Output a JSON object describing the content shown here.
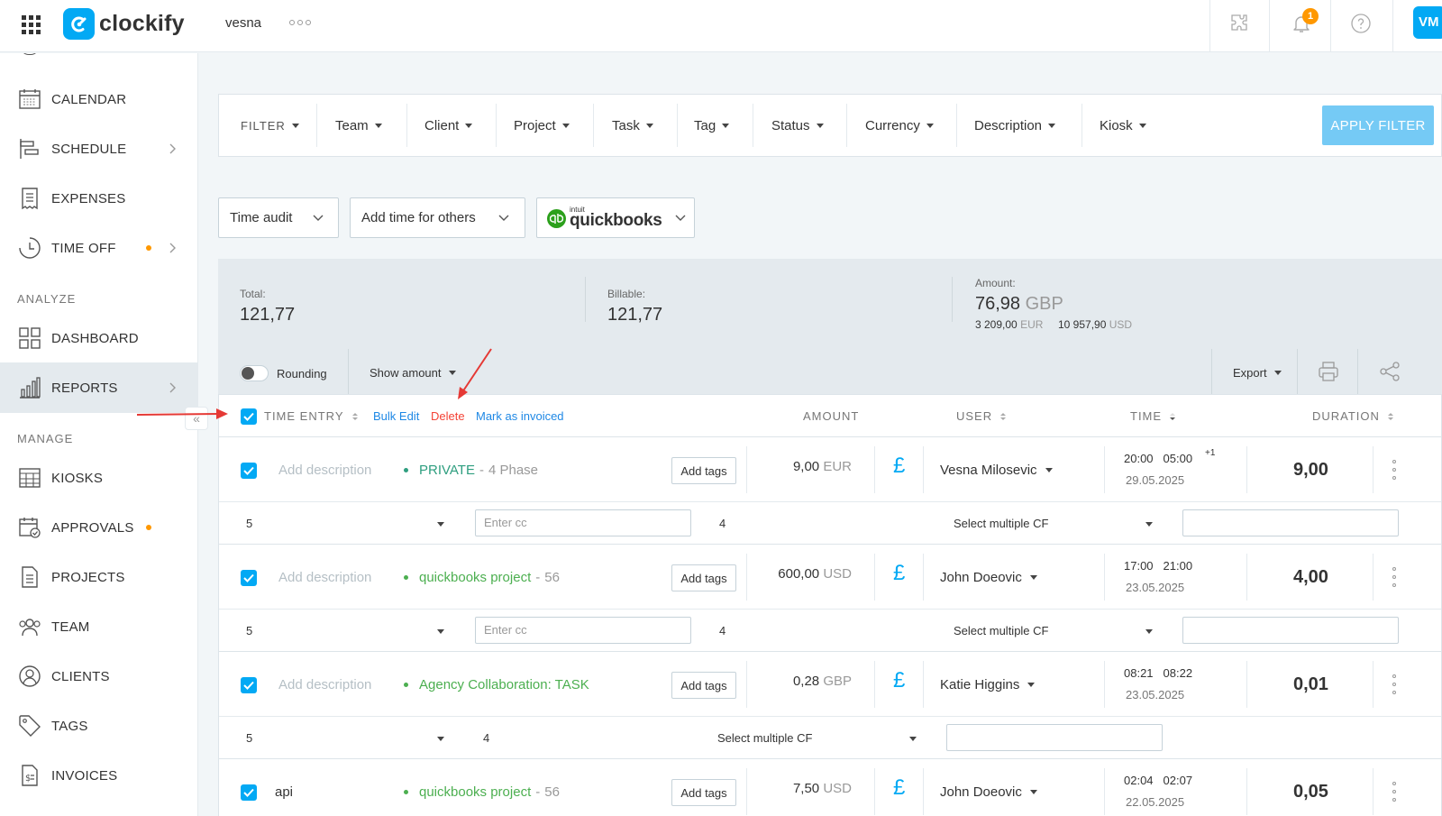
{
  "app": {
    "logo_text": "clockify",
    "workspace": "vesna",
    "avatar_initials": "VM",
    "notification_count": "1"
  },
  "colors": {
    "accent": "#03a9f4",
    "apply_bg": "#75caf5",
    "delete_red": "#f44336",
    "project_teal": "#2e9e7f",
    "project_green": "#4caf50",
    "orange_dot": "#ff9800"
  },
  "sidebar": {
    "items": [
      {
        "label": "CALENDAR",
        "icon": "calendar-icon"
      },
      {
        "label": "SCHEDULE",
        "icon": "schedule-icon",
        "chevron": true
      },
      {
        "label": "EXPENSES",
        "icon": "receipt-icon"
      },
      {
        "label": "TIME OFF",
        "icon": "clock-icon",
        "dot": true,
        "chevron": true
      },
      {
        "label": "DASHBOARD",
        "icon": "dashboard-icon"
      },
      {
        "label": "REPORTS",
        "icon": "bar-chart-icon",
        "chevron": true,
        "active": true
      },
      {
        "label": "KIOSKS",
        "icon": "kiosk-icon"
      },
      {
        "label": "APPROVALS",
        "icon": "approvals-icon",
        "dot": true
      },
      {
        "label": "PROJECTS",
        "icon": "document-icon"
      },
      {
        "label": "TEAM",
        "icon": "team-icon"
      },
      {
        "label": "CLIENTS",
        "icon": "client-icon"
      },
      {
        "label": "TAGS",
        "icon": "tag-icon"
      },
      {
        "label": "INVOICES",
        "icon": "invoice-icon"
      }
    ],
    "sections": {
      "analyze": "ANALYZE",
      "manage": "MANAGE"
    }
  },
  "filters": {
    "label": "FILTER",
    "items": [
      "Team",
      "Client",
      "Project",
      "Task",
      "Tag",
      "Status",
      "Currency",
      "Description",
      "Kiosk"
    ],
    "apply": "APPLY FILTER"
  },
  "dropdowns": {
    "time_audit": "Time audit",
    "add_time": "Add time for others",
    "qb_brand": "quickbooks",
    "qb_small": "intuit"
  },
  "summary": {
    "total_label": "Total:",
    "total_value": "121,77",
    "billable_label": "Billable:",
    "billable_value": "121,77",
    "amount_label": "Amount:",
    "amount_value": "76,98",
    "amount_unit": "GBP",
    "sub1_value": "3 209,00",
    "sub1_unit": "EUR",
    "sub2_value": "10 957,90",
    "sub2_unit": "USD",
    "rounding": "Rounding",
    "show_amount": "Show amount",
    "export": "Export"
  },
  "table": {
    "headers": {
      "time_entry": "TIME ENTRY",
      "bulk_edit": "Bulk Edit",
      "delete": "Delete",
      "mark_invoiced": "Mark as invoiced",
      "amount": "AMOUNT",
      "user": "USER",
      "time": "TIME",
      "duration": "DURATION"
    },
    "add_tags": "Add tags",
    "rows": [
      {
        "description": "Add description",
        "project": "PRIVATE",
        "extra": "4 Phase",
        "amount": "9,00",
        "currency": "EUR",
        "user": "Vesna Milosevic",
        "start": "20:00",
        "end": "05:00",
        "plus": "+1",
        "date": "29.05.2025",
        "duration": "9,00",
        "cf": {
          "num1": "5",
          "placeholder": "Enter cc",
          "num2": "4",
          "select": "Select multiple CF"
        }
      },
      {
        "description": "Add description",
        "project": "quickbooks project",
        "extra": "56",
        "amount": "600,00",
        "currency": "USD",
        "user": "John Doeovic",
        "start": "17:00",
        "end": "21:00",
        "date": "23.05.2025",
        "duration": "4,00",
        "cf": {
          "num1": "5",
          "placeholder": "Enter cc",
          "num2": "4",
          "select": "Select multiple CF"
        }
      },
      {
        "description": "Add description",
        "project": "Agency Collaboration: TASK",
        "amount": "0,28",
        "currency": "GBP",
        "user": "Katie Higgins",
        "start": "08:21",
        "end": "08:22",
        "date": "23.05.2025",
        "duration": "0,01",
        "cf": {
          "num1": "5",
          "num2": "4",
          "select": "Select multiple CF"
        }
      },
      {
        "description": "api",
        "project": "quickbooks project",
        "extra": "56",
        "amount": "7,50",
        "currency": "USD",
        "user": "John Doeovic",
        "start": "02:04",
        "end": "02:07",
        "date": "22.05.2025",
        "duration": "0,05"
      }
    ]
  }
}
